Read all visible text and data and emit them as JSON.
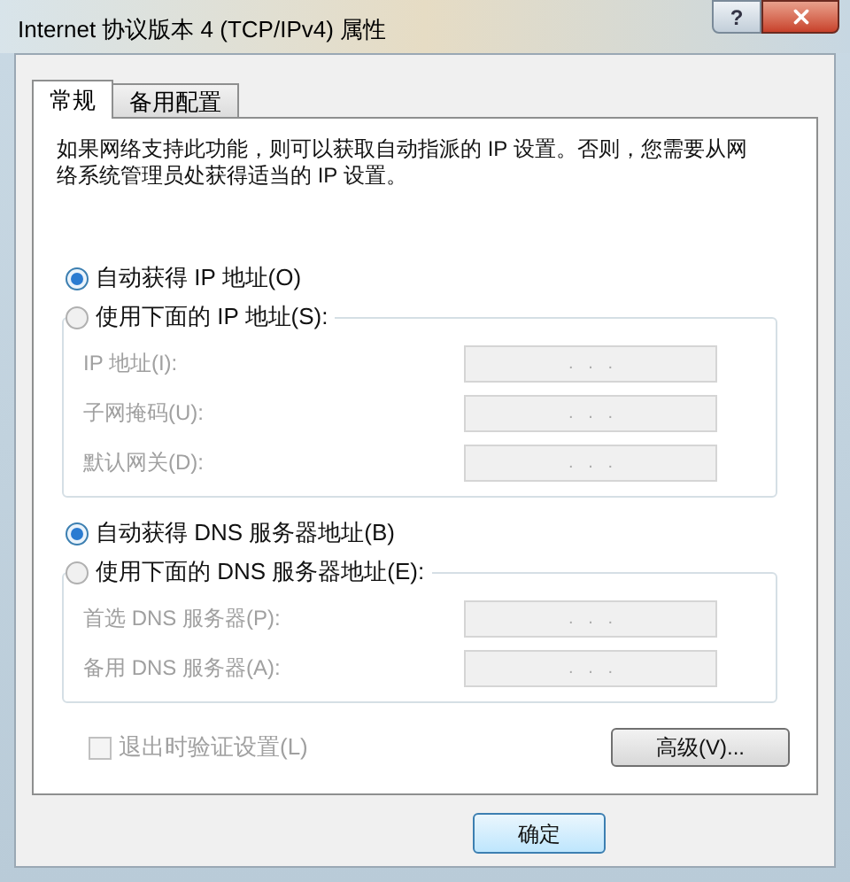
{
  "window": {
    "title": "Internet 协议版本 4 (TCP/IPv4) 属性",
    "help_button": "?"
  },
  "tabs": [
    {
      "label": "常规",
      "selected": true
    },
    {
      "label": "备用配置",
      "selected": false
    }
  ],
  "description": "如果网络支持此功能，则可以获取自动指派的 IP 设置。否则，您需要从网络系统管理员处获得适当的 IP 设置。",
  "ip_options": [
    {
      "label": "自动获得 IP 地址(O)",
      "selected": true
    },
    {
      "label": "使用下面的 IP 地址(S):",
      "selected": false
    }
  ],
  "ip_fields": [
    {
      "label": "IP 地址(I):",
      "value": ".   .   .",
      "disabled": true
    },
    {
      "label": "子网掩码(U):",
      "value": ".   .   .",
      "disabled": true
    },
    {
      "label": "默认网关(D):",
      "value": ".   .   .",
      "disabled": true
    }
  ],
  "dns_options": [
    {
      "label": "自动获得 DNS 服务器地址(B)",
      "selected": true
    },
    {
      "label": "使用下面的 DNS 服务器地址(E):",
      "selected": false
    }
  ],
  "dns_fields": [
    {
      "label": "首选 DNS 服务器(P):",
      "value": ".   .   .",
      "disabled": true
    },
    {
      "label": "备用 DNS 服务器(A):",
      "value": ".   .   .",
      "disabled": true
    }
  ],
  "validate_checkbox": {
    "label": "退出时验证设置(L)",
    "checked": false,
    "disabled": true
  },
  "advanced_button": "高级(V)...",
  "ok_button": "确定"
}
